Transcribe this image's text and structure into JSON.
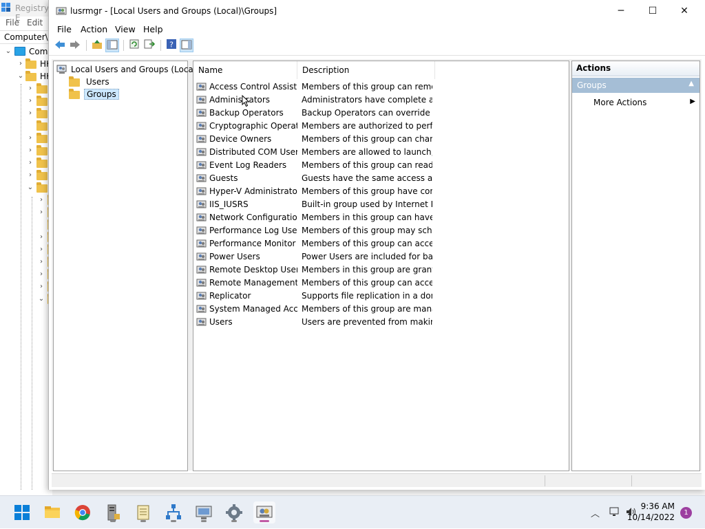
{
  "background_app": {
    "title": "Registry E",
    "menu": [
      "File",
      "Edit"
    ],
    "address": "Computer\\H",
    "tree": [
      {
        "label": "Comp"
      },
      {
        "label": "HK"
      },
      {
        "label": "HK"
      }
    ]
  },
  "window": {
    "title": "lusrmgr - [Local Users and Groups (Local)\\Groups]",
    "controls": {
      "minimize": "─",
      "maximize": "☐",
      "close": "✕"
    }
  },
  "menu": [
    "File",
    "Action",
    "View",
    "Help"
  ],
  "toolbar": {
    "back": "back-arrow-icon",
    "forward": "forward-arrow-icon",
    "up": "up-folder-icon",
    "show_hide_tree": "console-tree-icon",
    "refresh": "refresh-icon",
    "export": "export-list-icon",
    "help": "help-icon",
    "show_hide_action": "action-pane-icon"
  },
  "tree": {
    "root": "Local Users and Groups (Local)",
    "children": [
      {
        "label": "Users",
        "selected": false
      },
      {
        "label": "Groups",
        "selected": true
      }
    ]
  },
  "list": {
    "columns": [
      "Name",
      "Description"
    ],
    "rows": [
      {
        "name": "Access Control Assist...",
        "desc": "Members of this group can remot..."
      },
      {
        "name": "Administrators",
        "desc": "Administrators have complete an..."
      },
      {
        "name": "Backup Operators",
        "desc": "Backup Operators can override se..."
      },
      {
        "name": "Cryptographic Operat...",
        "desc": "Members are authorized to perfor..."
      },
      {
        "name": "Device Owners",
        "desc": "Members of this group can chang..."
      },
      {
        "name": "Distributed COM Users",
        "desc": "Members are allowed to launch, a..."
      },
      {
        "name": "Event Log Readers",
        "desc": "Members of this group can read e..."
      },
      {
        "name": "Guests",
        "desc": "Guests have the same access as m..."
      },
      {
        "name": "Hyper-V Administrators",
        "desc": "Members of this group have com..."
      },
      {
        "name": "IIS_IUSRS",
        "desc": "Built-in group used by Internet Inf..."
      },
      {
        "name": "Network Configuratio...",
        "desc": "Members in this group can have s..."
      },
      {
        "name": "Performance Log Users",
        "desc": "Members of this group may sche..."
      },
      {
        "name": "Performance Monitor ...",
        "desc": "Members of this group can acces..."
      },
      {
        "name": "Power Users",
        "desc": "Power Users are included for back..."
      },
      {
        "name": "Remote Desktop Users",
        "desc": "Members in this group are grante..."
      },
      {
        "name": "Remote Management...",
        "desc": "Members of this group can acces..."
      },
      {
        "name": "Replicator",
        "desc": "Supports file replication in a dom..."
      },
      {
        "name": "System Managed Acc...",
        "desc": "Members of this group are mana..."
      },
      {
        "name": "Users",
        "desc": "Users are prevented from making ..."
      }
    ]
  },
  "actions": {
    "header": "Actions",
    "section": "Groups",
    "items": [
      "More Actions"
    ]
  },
  "taskbar": {
    "apps": [
      "start-icon",
      "file-explorer-icon",
      "chrome-icon",
      "server-manager-icon",
      "notepad-icon",
      "network-icon",
      "remote-desktop-icon",
      "settings-icon",
      "lusrmgr-icon"
    ],
    "clock": {
      "time": "9:36 AM",
      "date": "10/14/2022"
    },
    "notifications": "1"
  },
  "colors": {
    "accent": "#0067c0",
    "selection": "#cce8ff",
    "action_section": "#a5bed6"
  }
}
